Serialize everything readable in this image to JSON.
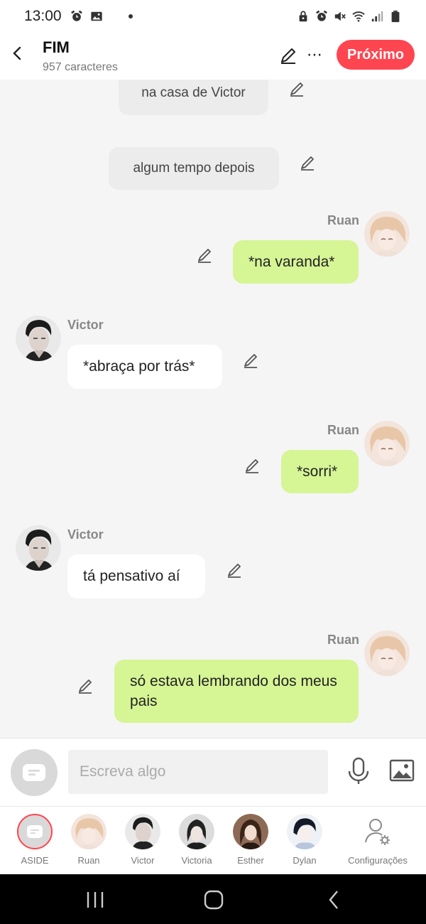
{
  "status_bar": {
    "time": "13:00",
    "left_icons": [
      "alarm-icon",
      "image-icon"
    ],
    "right_icons": [
      "lock-icon",
      "alarm-icon",
      "mute-icon",
      "wifi-icon",
      "signal-icon",
      "battery-icon"
    ]
  },
  "header": {
    "title": "FIM",
    "subtitle": "957 caracteres",
    "next_label": "Próximo"
  },
  "messages": [
    {
      "type": "narration",
      "text": "na casa de Victor"
    },
    {
      "type": "narration",
      "text": "algum tempo depois"
    },
    {
      "type": "message",
      "side": "right",
      "speaker": "Ruan",
      "text": "*na varanda*"
    },
    {
      "type": "message",
      "side": "left",
      "speaker": "Victor",
      "text": "*abraça por trás*"
    },
    {
      "type": "message",
      "side": "right",
      "speaker": "Ruan",
      "text": "*sorri*"
    },
    {
      "type": "message",
      "side": "left",
      "speaker": "Victor",
      "text": "tá pensativo aí"
    },
    {
      "type": "message",
      "side": "right",
      "speaker": "Ruan",
      "text": "só estava lembrando dos meus pais"
    }
  ],
  "composer": {
    "placeholder": "Escreva algo"
  },
  "characters": [
    {
      "label": "ASIDE"
    },
    {
      "label": "Ruan"
    },
    {
      "label": "Victor"
    },
    {
      "label": "Victoria"
    },
    {
      "label": "Esther"
    },
    {
      "label": "Dylan"
    },
    {
      "label": "Configurações"
    }
  ],
  "colors": {
    "accent": "#ff4550",
    "green_bubble": "#d6f595",
    "white_bubble": "#ffffff",
    "narration_bubble": "#ececec",
    "background": "#f5f5f5"
  }
}
